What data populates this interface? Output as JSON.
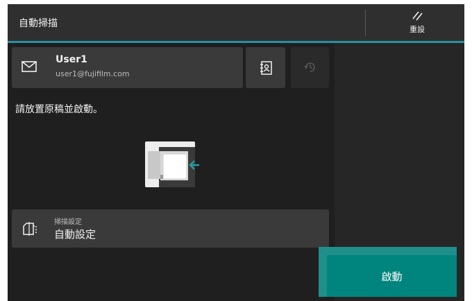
{
  "header": {
    "title": "自動掃描",
    "reset_label": "重設"
  },
  "recipient": {
    "name": "User1",
    "email": "user1@fujifilm.com"
  },
  "instruction": "請放置原稿並啟動。",
  "scan_settings": {
    "label": "掃描設定",
    "value": "自動設定"
  },
  "start_label": "啟動",
  "icons": {
    "mail": "mail-icon",
    "address_book": "address-book-icon",
    "history": "history-icon",
    "reset": "reset-icon",
    "scan_settings": "document-settings-icon"
  },
  "colors": {
    "accent": "#2b8fa0",
    "start": "#00857e",
    "arrow": "#2a9aa0"
  }
}
